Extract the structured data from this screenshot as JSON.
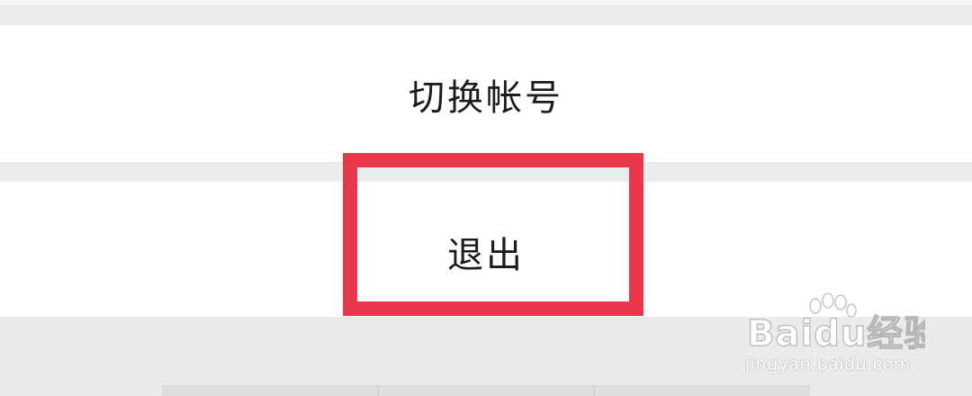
{
  "menu": {
    "switch_account_label": "切换帐号",
    "logout_label": "退出"
  },
  "annotation": {
    "highlight_color": "#e8374a"
  },
  "watermark": {
    "logo_text": "Baidu经验",
    "url_text": "jingyan.baidu.com"
  },
  "colors": {
    "background": "#ececec",
    "row_background": "#ffffff",
    "text": "#1c1c1c"
  }
}
